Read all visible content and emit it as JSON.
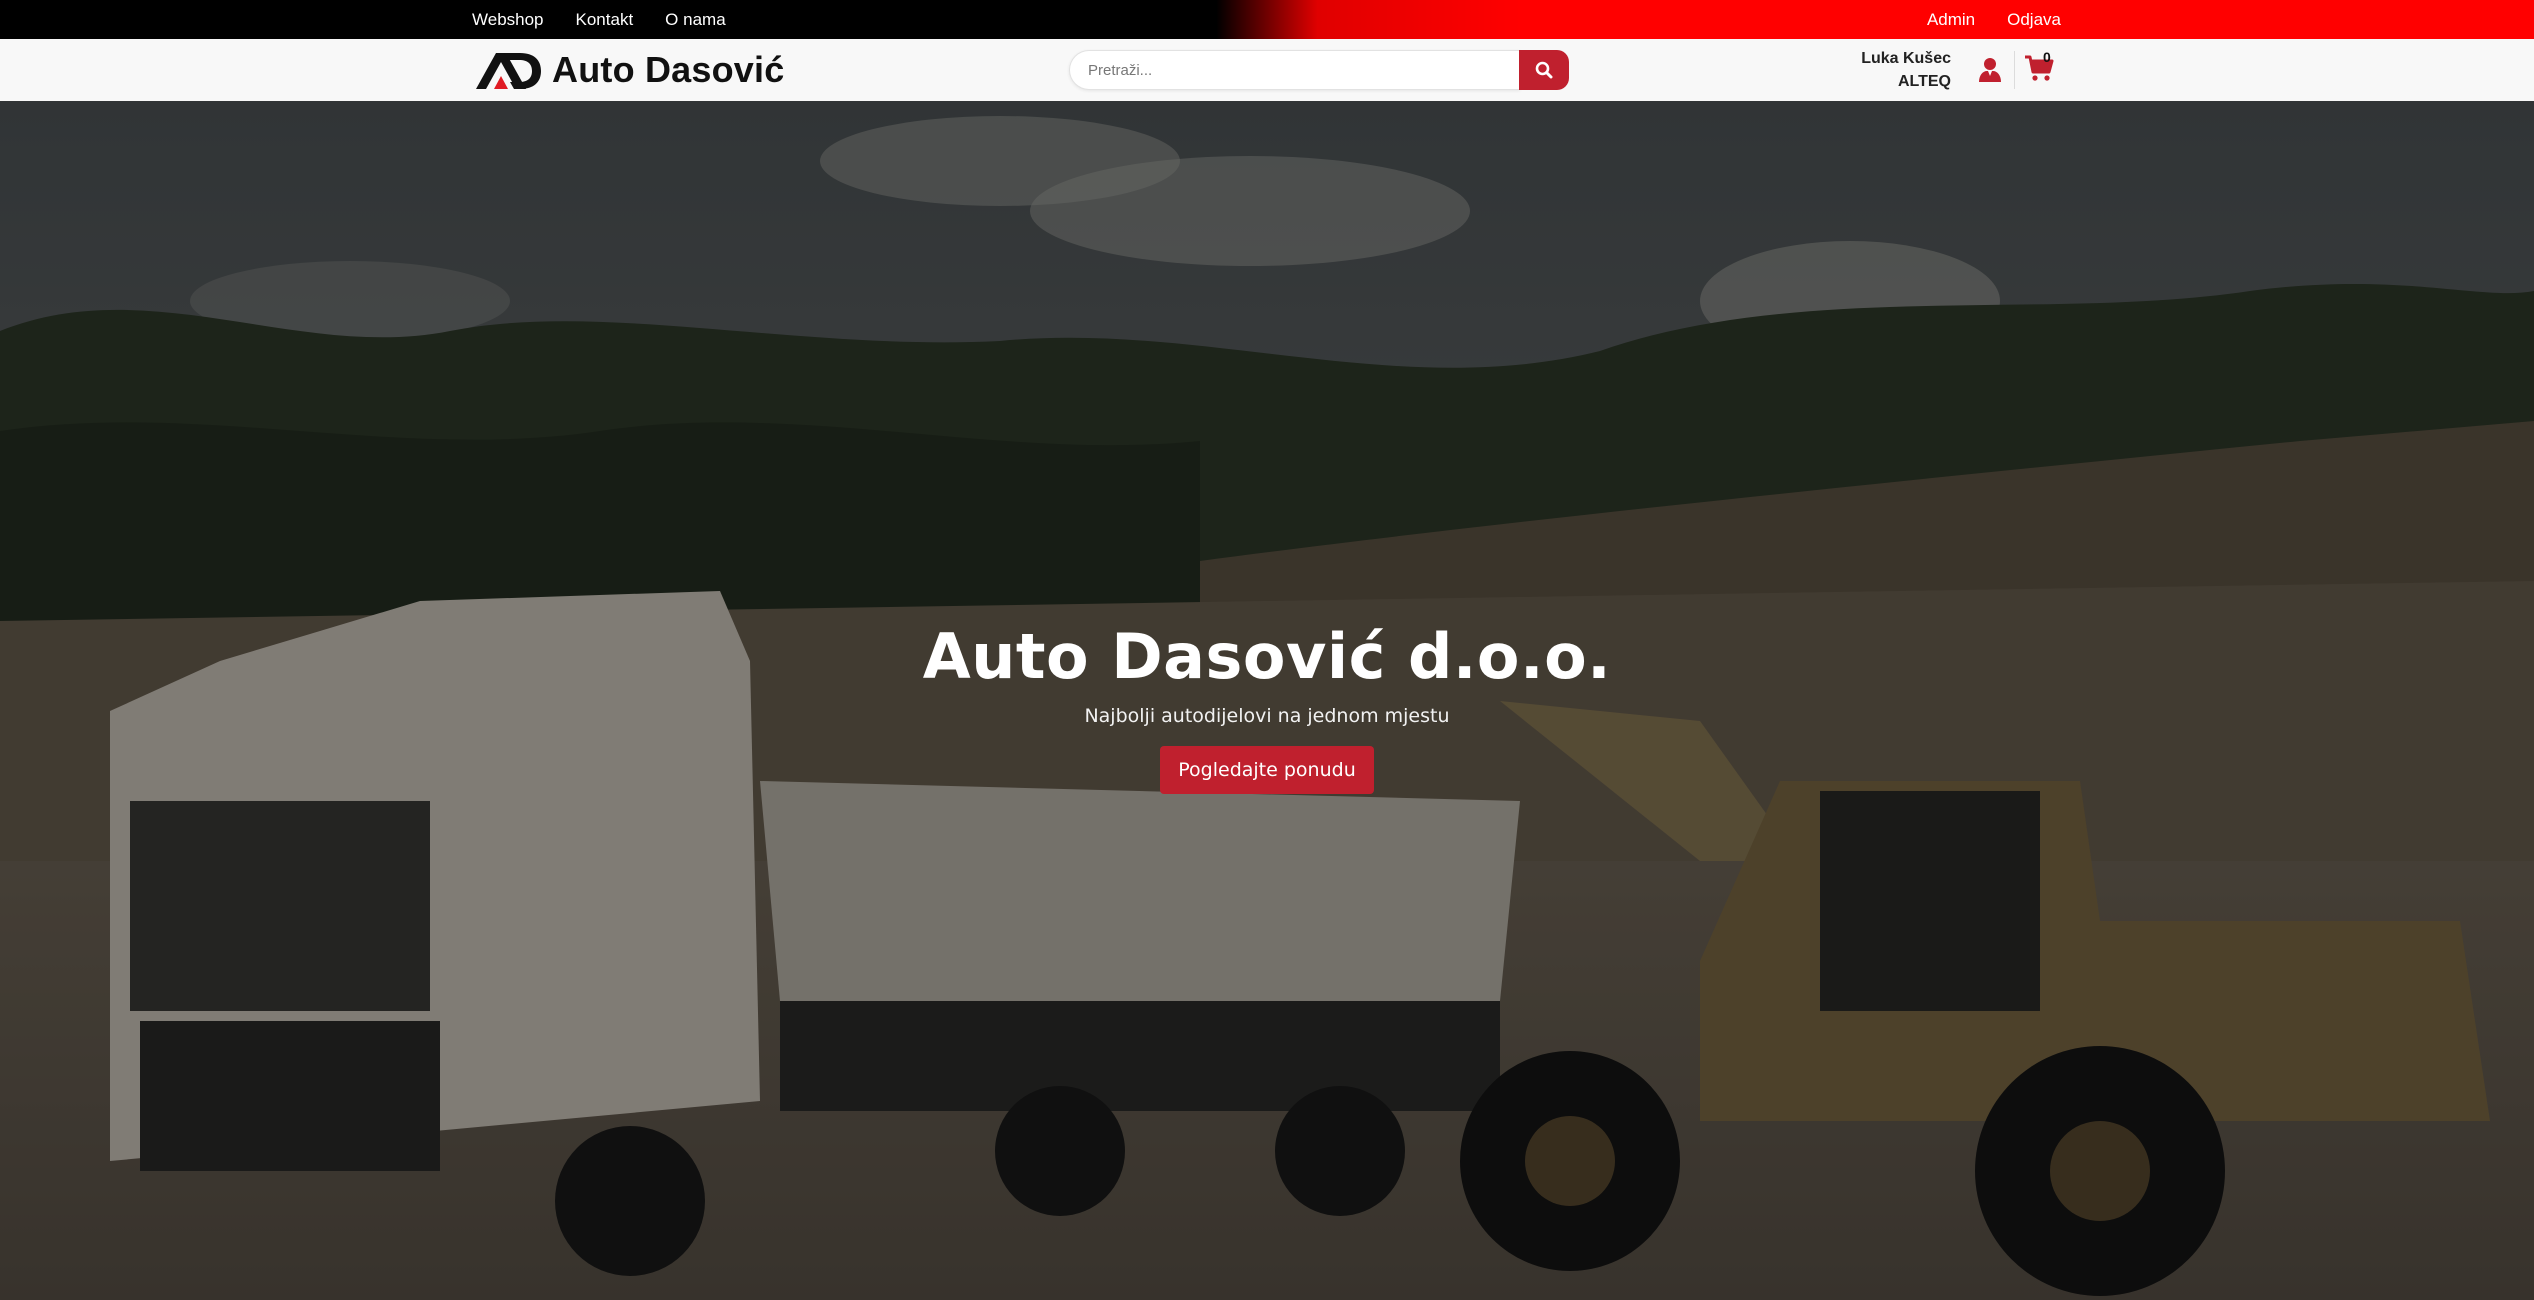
{
  "topbar": {
    "left_links": [
      "Webshop",
      "Kontakt",
      "O nama"
    ],
    "right_links": [
      "Admin",
      "Odjava"
    ],
    "colors": {
      "left": "#000000",
      "right": "#ff0000"
    }
  },
  "header": {
    "logo_text": "Auto Dasović",
    "search": {
      "placeholder": "Pretraži...",
      "value": "",
      "button_icon": "search-icon"
    },
    "user": {
      "name": "Luka Kušec",
      "company": "ALTEQ"
    },
    "user_icon": "user-icon",
    "cart": {
      "icon": "shopping-cart-icon",
      "count": "0"
    }
  },
  "hero": {
    "title": "Auto Dasović d.o.o.",
    "subtitle": "Najbolji autodijelovi na jednom mjestu",
    "button_label": "Pogledajte ponudu",
    "accent_color": "#c0202e"
  }
}
